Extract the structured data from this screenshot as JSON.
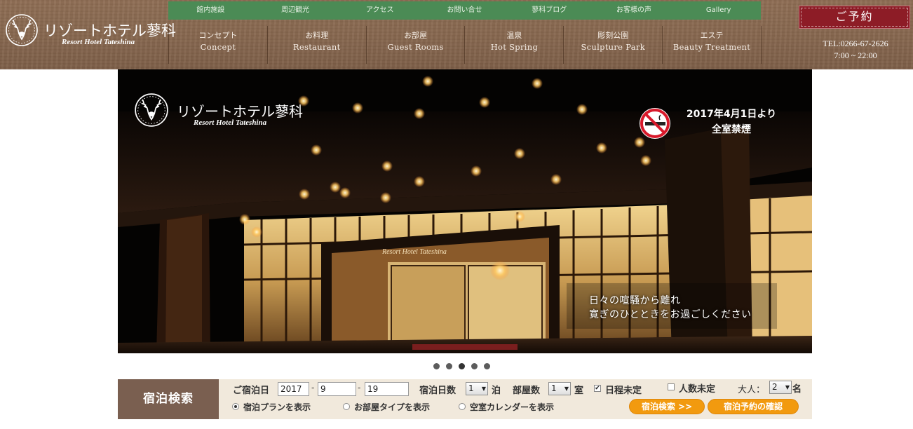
{
  "site": {
    "name_jp": "リゾートホテル蓼科",
    "name_en": "Resort Hotel Tateshina"
  },
  "subnav": [
    "館内施設",
    "周辺観光",
    "アクセス",
    "お問い合せ",
    "蓼科ブログ",
    "お客様の声",
    "Gallery"
  ],
  "mainnav": [
    {
      "jp": "コンセプト",
      "en": "Concept"
    },
    {
      "jp": "お料理",
      "en": "Restaurant"
    },
    {
      "jp": "お部屋",
      "en": "Guest Rooms"
    },
    {
      "jp": "温泉",
      "en": "Hot Spring"
    },
    {
      "jp": "彫刻公園",
      "en": "Sculpture Park"
    },
    {
      "jp": "エステ",
      "en": "Beauty Treatment"
    }
  ],
  "reserve": {
    "label": "ご予約",
    "tel": "TEL:0266-67-2626",
    "hours": "7:00 ~ 22:00"
  },
  "hero": {
    "logo_jp": "リゾートホテル蓼科",
    "logo_en": "Resort Hotel Tateshina",
    "sign": "Resort Hotel Tateshina",
    "notice_line1": "2017年4月1日より",
    "notice_line2": "全室禁煙",
    "caption_line1": "日々の喧騒から離れ",
    "caption_line2": "寛ぎのひとときをお過ごしください",
    "slides": 5,
    "active_slide": 3
  },
  "search": {
    "title": "宿泊検索",
    "checkin_label": "ご宿泊日",
    "year": "2017",
    "month": "9",
    "day": "19",
    "nights_label": "宿泊日数",
    "nights": "1",
    "nights_unit": "泊",
    "rooms_label": "部屋数",
    "rooms": "1",
    "rooms_unit": "室",
    "undecided_date": "日程未定",
    "undecided_date_checked": true,
    "undecided_people": "人数未定",
    "undecided_people_checked": false,
    "adults_label": "大人：",
    "adults": "2",
    "adults_unit": "名",
    "radio_options": [
      "宿泊プランを表示",
      "お部屋タイプを表示",
      "空室カレンダーを表示"
    ],
    "radio_selected": 0,
    "search_button": "宿泊検索 >>",
    "confirm_button": "宿泊予約の確認"
  }
}
